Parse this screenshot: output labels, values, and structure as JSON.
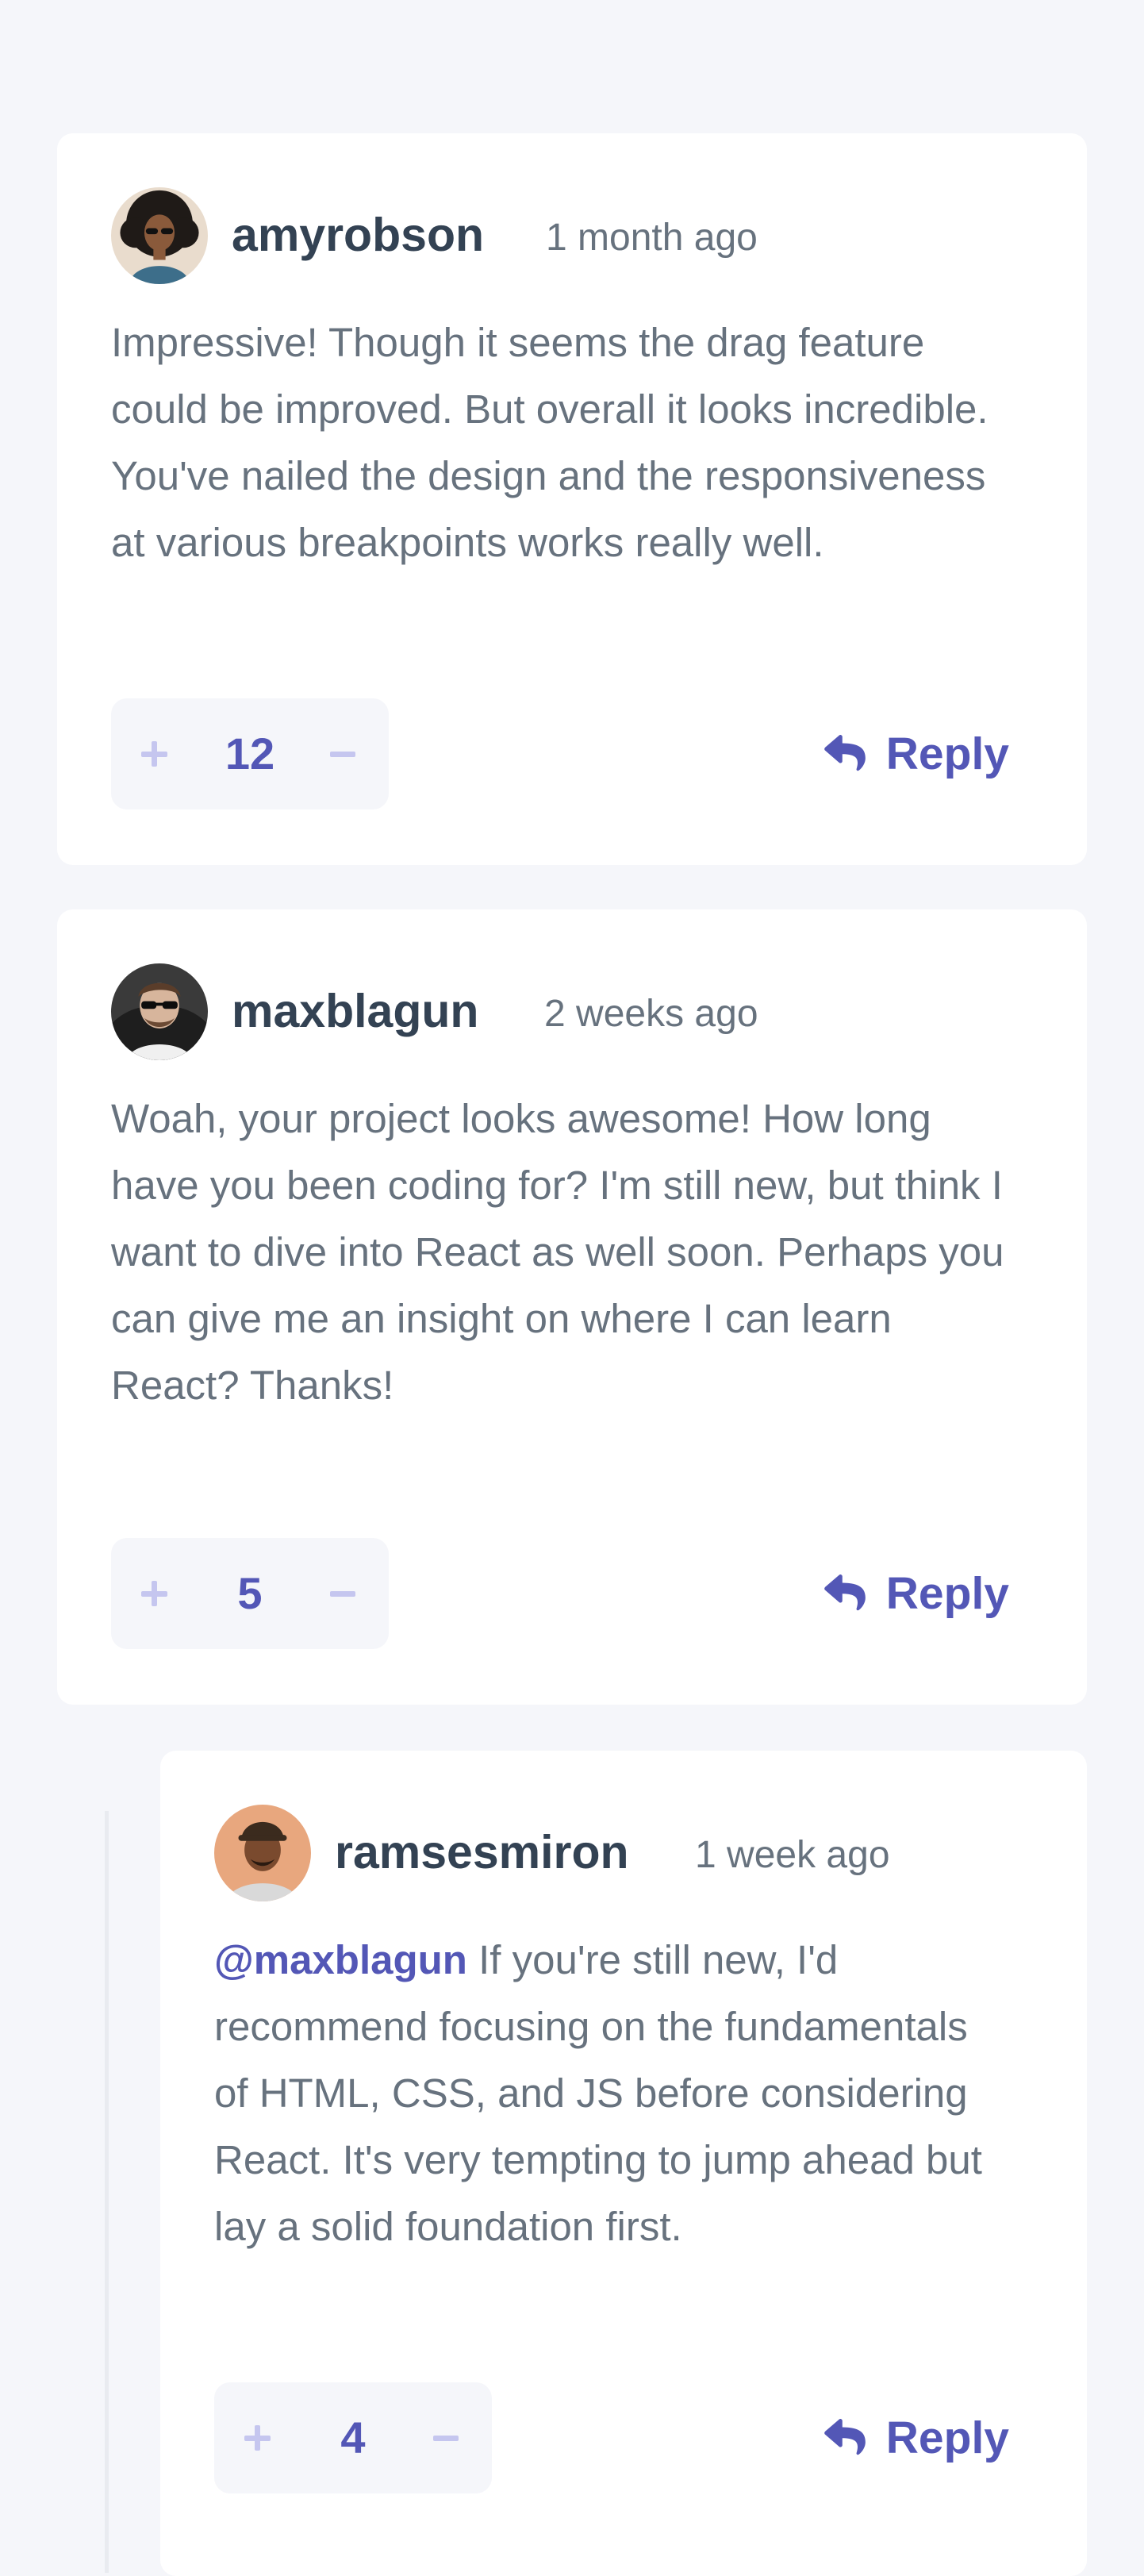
{
  "colors": {
    "background": "#f5f6fa",
    "card": "#ffffff",
    "accent": "#5357b6",
    "accent_light": "#c5c6ef",
    "heading": "#334253",
    "body_text": "#67727e"
  },
  "comments": [
    {
      "username": "amyrobson",
      "created_at": "1 month ago",
      "content": "Impressive! Though it seems the drag feature could be improved. But overall it looks incredible. You've nailed the design and the responsiveness at various breakpoints works really well.",
      "score": "12",
      "reply_label": "Reply",
      "avatar_icon": "avatar-amyrobson"
    },
    {
      "username": "maxblagun",
      "created_at": "2 weeks ago",
      "content": "Woah, your project looks awesome! How long have you been coding for? I'm still new, but think I want to dive into React as well soon. Perhaps you can give me an insight on where I can learn React? Thanks!",
      "score": "5",
      "reply_label": "Reply",
      "avatar_icon": "avatar-maxblagun",
      "replies": [
        {
          "username": "ramsesmiron",
          "created_at": "1 week ago",
          "replying_to": "@maxblagun",
          "content": "If you're still new, I'd recommend focusing on the fundamentals of HTML, CSS, and JS before considering React. It's very tempting to jump ahead but lay a solid foundation first.",
          "score": "4",
          "reply_label": "Reply",
          "avatar_icon": "avatar-ramsesmiron"
        }
      ]
    }
  ],
  "icons": {
    "upvote": "plus-icon",
    "downvote": "minus-icon",
    "reply": "reply-arrow-icon"
  }
}
